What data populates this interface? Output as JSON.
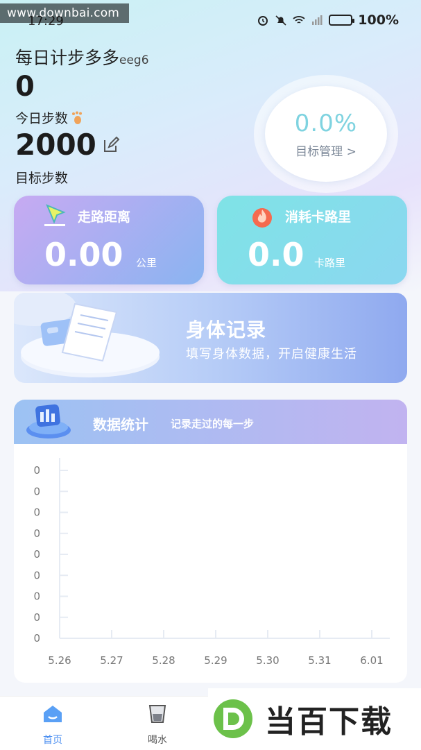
{
  "watermark_top": "www.downbai.com",
  "status": {
    "time": "17:29",
    "battery": "100%"
  },
  "header": {
    "app_name": "每日计步多多",
    "user_tag": "eeg6",
    "today_steps": "0",
    "today_steps_label": "今日步数",
    "goal_steps": "2000",
    "goal_label": "目标步数"
  },
  "progress": {
    "percent": "0.0%",
    "link": "目标管理 >"
  },
  "cards": {
    "walk": {
      "title": "走路距离",
      "value": "0.00",
      "unit": "公里"
    },
    "calorie": {
      "title": "消耗卡路里",
      "value": "0.0",
      "unit": "卡路里"
    }
  },
  "body_record": {
    "title": "身体记录",
    "subtitle": "填写身体数据，开启健康生活"
  },
  "stats": {
    "title": "数据统计",
    "subtitle": "记录走过的每一步"
  },
  "chart_data": {
    "type": "line",
    "title": "",
    "xlabel": "",
    "ylabel": "",
    "categories": [
      "5.26",
      "5.27",
      "5.28",
      "5.29",
      "5.30",
      "5.31",
      "6.01"
    ],
    "series": [
      {
        "values": [
          0,
          0,
          0,
          0,
          0,
          0,
          0
        ]
      }
    ],
    "y_tick_labels": [
      "0",
      "0",
      "0",
      "0",
      "0",
      "0",
      "0",
      "0",
      "0"
    ],
    "grid": false
  },
  "tabs": [
    {
      "label": "首页",
      "icon": "home-icon",
      "active": true
    },
    {
      "label": "喝水",
      "icon": "cup-icon",
      "active": false
    }
  ],
  "watermark_bottom": {
    "logo_letter": "D",
    "text": "当百下载"
  },
  "colors": {
    "accent": "#4a8ef0",
    "progress_text": "#7fd3e0"
  }
}
